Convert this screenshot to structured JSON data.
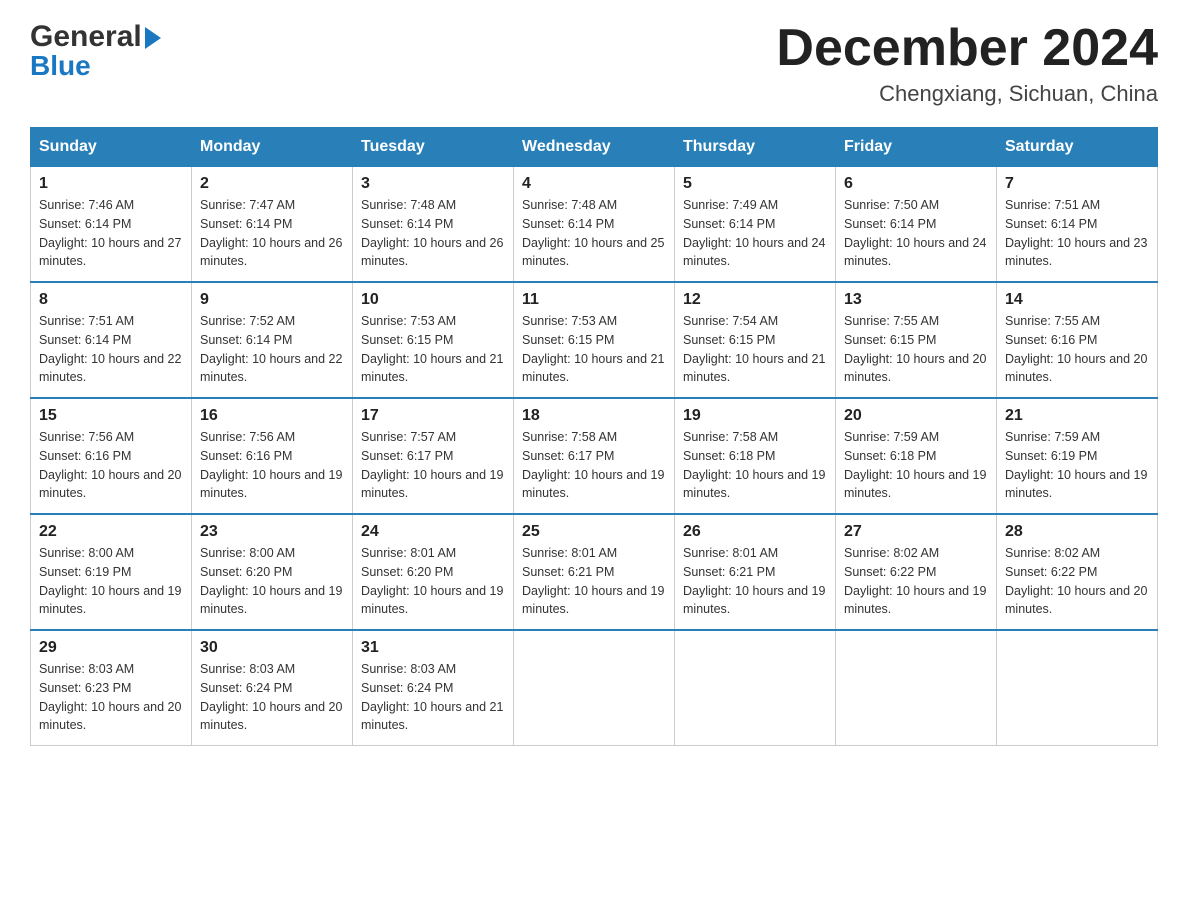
{
  "header": {
    "logo_line1": "General",
    "logo_line2": "Blue",
    "month": "December 2024",
    "location": "Chengxiang, Sichuan, China"
  },
  "days_of_week": [
    "Sunday",
    "Monday",
    "Tuesday",
    "Wednesday",
    "Thursday",
    "Friday",
    "Saturday"
  ],
  "weeks": [
    [
      {
        "day": 1,
        "sunrise": "7:46 AM",
        "sunset": "6:14 PM",
        "daylight": "10 hours and 27 minutes."
      },
      {
        "day": 2,
        "sunrise": "7:47 AM",
        "sunset": "6:14 PM",
        "daylight": "10 hours and 26 minutes."
      },
      {
        "day": 3,
        "sunrise": "7:48 AM",
        "sunset": "6:14 PM",
        "daylight": "10 hours and 26 minutes."
      },
      {
        "day": 4,
        "sunrise": "7:48 AM",
        "sunset": "6:14 PM",
        "daylight": "10 hours and 25 minutes."
      },
      {
        "day": 5,
        "sunrise": "7:49 AM",
        "sunset": "6:14 PM",
        "daylight": "10 hours and 24 minutes."
      },
      {
        "day": 6,
        "sunrise": "7:50 AM",
        "sunset": "6:14 PM",
        "daylight": "10 hours and 24 minutes."
      },
      {
        "day": 7,
        "sunrise": "7:51 AM",
        "sunset": "6:14 PM",
        "daylight": "10 hours and 23 minutes."
      }
    ],
    [
      {
        "day": 8,
        "sunrise": "7:51 AM",
        "sunset": "6:14 PM",
        "daylight": "10 hours and 22 minutes."
      },
      {
        "day": 9,
        "sunrise": "7:52 AM",
        "sunset": "6:14 PM",
        "daylight": "10 hours and 22 minutes."
      },
      {
        "day": 10,
        "sunrise": "7:53 AM",
        "sunset": "6:15 PM",
        "daylight": "10 hours and 21 minutes."
      },
      {
        "day": 11,
        "sunrise": "7:53 AM",
        "sunset": "6:15 PM",
        "daylight": "10 hours and 21 minutes."
      },
      {
        "day": 12,
        "sunrise": "7:54 AM",
        "sunset": "6:15 PM",
        "daylight": "10 hours and 21 minutes."
      },
      {
        "day": 13,
        "sunrise": "7:55 AM",
        "sunset": "6:15 PM",
        "daylight": "10 hours and 20 minutes."
      },
      {
        "day": 14,
        "sunrise": "7:55 AM",
        "sunset": "6:16 PM",
        "daylight": "10 hours and 20 minutes."
      }
    ],
    [
      {
        "day": 15,
        "sunrise": "7:56 AM",
        "sunset": "6:16 PM",
        "daylight": "10 hours and 20 minutes."
      },
      {
        "day": 16,
        "sunrise": "7:56 AM",
        "sunset": "6:16 PM",
        "daylight": "10 hours and 19 minutes."
      },
      {
        "day": 17,
        "sunrise": "7:57 AM",
        "sunset": "6:17 PM",
        "daylight": "10 hours and 19 minutes."
      },
      {
        "day": 18,
        "sunrise": "7:58 AM",
        "sunset": "6:17 PM",
        "daylight": "10 hours and 19 minutes."
      },
      {
        "day": 19,
        "sunrise": "7:58 AM",
        "sunset": "6:18 PM",
        "daylight": "10 hours and 19 minutes."
      },
      {
        "day": 20,
        "sunrise": "7:59 AM",
        "sunset": "6:18 PM",
        "daylight": "10 hours and 19 minutes."
      },
      {
        "day": 21,
        "sunrise": "7:59 AM",
        "sunset": "6:19 PM",
        "daylight": "10 hours and 19 minutes."
      }
    ],
    [
      {
        "day": 22,
        "sunrise": "8:00 AM",
        "sunset": "6:19 PM",
        "daylight": "10 hours and 19 minutes."
      },
      {
        "day": 23,
        "sunrise": "8:00 AM",
        "sunset": "6:20 PM",
        "daylight": "10 hours and 19 minutes."
      },
      {
        "day": 24,
        "sunrise": "8:01 AM",
        "sunset": "6:20 PM",
        "daylight": "10 hours and 19 minutes."
      },
      {
        "day": 25,
        "sunrise": "8:01 AM",
        "sunset": "6:21 PM",
        "daylight": "10 hours and 19 minutes."
      },
      {
        "day": 26,
        "sunrise": "8:01 AM",
        "sunset": "6:21 PM",
        "daylight": "10 hours and 19 minutes."
      },
      {
        "day": 27,
        "sunrise": "8:02 AM",
        "sunset": "6:22 PM",
        "daylight": "10 hours and 19 minutes."
      },
      {
        "day": 28,
        "sunrise": "8:02 AM",
        "sunset": "6:22 PM",
        "daylight": "10 hours and 20 minutes."
      }
    ],
    [
      {
        "day": 29,
        "sunrise": "8:03 AM",
        "sunset": "6:23 PM",
        "daylight": "10 hours and 20 minutes."
      },
      {
        "day": 30,
        "sunrise": "8:03 AM",
        "sunset": "6:24 PM",
        "daylight": "10 hours and 20 minutes."
      },
      {
        "day": 31,
        "sunrise": "8:03 AM",
        "sunset": "6:24 PM",
        "daylight": "10 hours and 21 minutes."
      },
      null,
      null,
      null,
      null
    ]
  ]
}
